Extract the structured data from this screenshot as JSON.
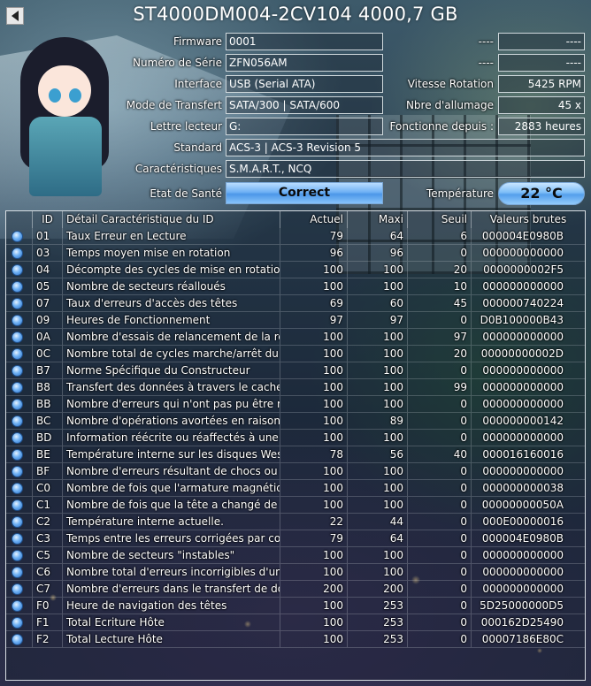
{
  "title": "ST4000DM004-2CV104 4000,7 GB",
  "info": {
    "firmware_label": "Firmware",
    "firmware": "0001",
    "serial_label": "Numéro de Série",
    "serial": "ZFN056AM",
    "interface_label": "Interface",
    "interface": "USB (Serial ATA)",
    "transfer_label": "Mode de Transfert",
    "transfer": "SATA/300 | SATA/600",
    "letter_label": "Lettre lecteur",
    "letter": "G:",
    "standard_label": "Standard",
    "standard": "ACS-3 | ACS-3 Revision 5",
    "features_label": "Caractéristiques",
    "features": "S.M.A.R.T., NCQ",
    "health_label": "Etat de Santé",
    "health": "Correct",
    "temp_label": "Température",
    "temp": "22 °C",
    "blank1_left": "----",
    "blank1_right": "----",
    "blank2_left": "----",
    "blank2_right": "----",
    "rotation_label": "Vitesse Rotation",
    "rotation": "5425 RPM",
    "power_count_label": "Nbre d'allumage",
    "power_count": "45 x",
    "power_on_label": "Fonctionne depuis :",
    "power_on": "2883 heures"
  },
  "table": {
    "headers": {
      "id": "ID",
      "detail": "Détail Caractéristique du ID",
      "current": "Actuel",
      "worst": "Maxi",
      "threshold": "Seuil",
      "raw": "Valeurs brutes"
    },
    "rows": [
      {
        "id": "01",
        "detail": "Taux Erreur en Lecture",
        "current": "79",
        "worst": "64",
        "threshold": "6",
        "raw": "000004E0980B"
      },
      {
        "id": "03",
        "detail": "Temps moyen mise en rotation",
        "current": "96",
        "worst": "96",
        "threshold": "0",
        "raw": "000000000000"
      },
      {
        "id": "04",
        "detail": "Décompte des cycles de mise en rotation",
        "current": "100",
        "worst": "100",
        "threshold": "20",
        "raw": "0000000002F5"
      },
      {
        "id": "05",
        "detail": "Nombre de secteurs réalloués",
        "current": "100",
        "worst": "100",
        "threshold": "10",
        "raw": "000000000000"
      },
      {
        "id": "07",
        "detail": "Taux d'erreurs d'accès des têtes",
        "current": "69",
        "worst": "60",
        "threshold": "45",
        "raw": "000000740224"
      },
      {
        "id": "09",
        "detail": "Heures de Fonctionnement",
        "current": "97",
        "worst": "97",
        "threshold": "0",
        "raw": "D0B100000B43"
      },
      {
        "id": "0A",
        "detail": "Nombre d'essais de relancement de la rotati...",
        "current": "100",
        "worst": "100",
        "threshold": "97",
        "raw": "000000000000"
      },
      {
        "id": "0C",
        "detail": "Nombre total de cycles marche/arrêt du dis...",
        "current": "100",
        "worst": "100",
        "threshold": "20",
        "raw": "00000000002D"
      },
      {
        "id": "B7",
        "detail": "Norme Spécifique du Constructeur",
        "current": "100",
        "worst": "100",
        "threshold": "0",
        "raw": "000000000000"
      },
      {
        "id": "B8",
        "detail": "Transfert des données à travers le cache tam...",
        "current": "100",
        "worst": "100",
        "threshold": "99",
        "raw": "000000000000"
      },
      {
        "id": "BB",
        "detail": "Nombre d'erreurs qui n'ont pas pu être récu...",
        "current": "100",
        "worst": "100",
        "threshold": "0",
        "raw": "000000000000"
      },
      {
        "id": "BC",
        "detail": "Nombre d'opérations avortées en raison de ...",
        "current": "100",
        "worst": "89",
        "threshold": "0",
        "raw": "000000000142"
      },
      {
        "id": "BD",
        "detail": "Information réécrite ou réaffectés à une régi...",
        "current": "100",
        "worst": "100",
        "threshold": "0",
        "raw": "000000000000"
      },
      {
        "id": "BE",
        "detail": "Température interne sur les disques Western ...",
        "current": "78",
        "worst": "56",
        "threshold": "40",
        "raw": "000016160016"
      },
      {
        "id": "BF",
        "detail": "Nombre d'erreurs résultant de chocs ou de v...",
        "current": "100",
        "worst": "100",
        "threshold": "0",
        "raw": "000000000000"
      },
      {
        "id": "C0",
        "detail": "Nombre de fois que l'armature magnétique ...",
        "current": "100",
        "worst": "100",
        "threshold": "0",
        "raw": "000000000038"
      },
      {
        "id": "C1",
        "detail": "Nombre de fois que la tête a changé de posi...",
        "current": "100",
        "worst": "100",
        "threshold": "0",
        "raw": "00000000050A"
      },
      {
        "id": "C2",
        "detail": "Température interne actuelle.",
        "current": "22",
        "worst": "44",
        "threshold": "0",
        "raw": "000E00000016"
      },
      {
        "id": "C3",
        "detail": "Temps entre les erreurs corrigées par code c...",
        "current": "79",
        "worst": "64",
        "threshold": "0",
        "raw": "000004E0980B"
      },
      {
        "id": "C5",
        "detail": "Nombre de secteurs \"instables\"",
        "current": "100",
        "worst": "100",
        "threshold": "0",
        "raw": "000000000000"
      },
      {
        "id": "C6",
        "detail": "Nombre total d'erreurs incorrigibles d'un se...",
        "current": "100",
        "worst": "100",
        "threshold": "0",
        "raw": "000000000000"
      },
      {
        "id": "C7",
        "detail": "Nombre d'erreurs dans le transfert de donné...",
        "current": "200",
        "worst": "200",
        "threshold": "0",
        "raw": "000000000000"
      },
      {
        "id": "F0",
        "detail": "Heure de navigation des têtes",
        "current": "100",
        "worst": "253",
        "threshold": "0",
        "raw": "5D25000000D5"
      },
      {
        "id": "F1",
        "detail": "Total Ecriture Hôte",
        "current": "100",
        "worst": "253",
        "threshold": "0",
        "raw": "000162D25490"
      },
      {
        "id": "F2",
        "detail": "Total Lecture Hôte",
        "current": "100",
        "worst": "253",
        "threshold": "0",
        "raw": "00007186E80C"
      }
    ]
  }
}
